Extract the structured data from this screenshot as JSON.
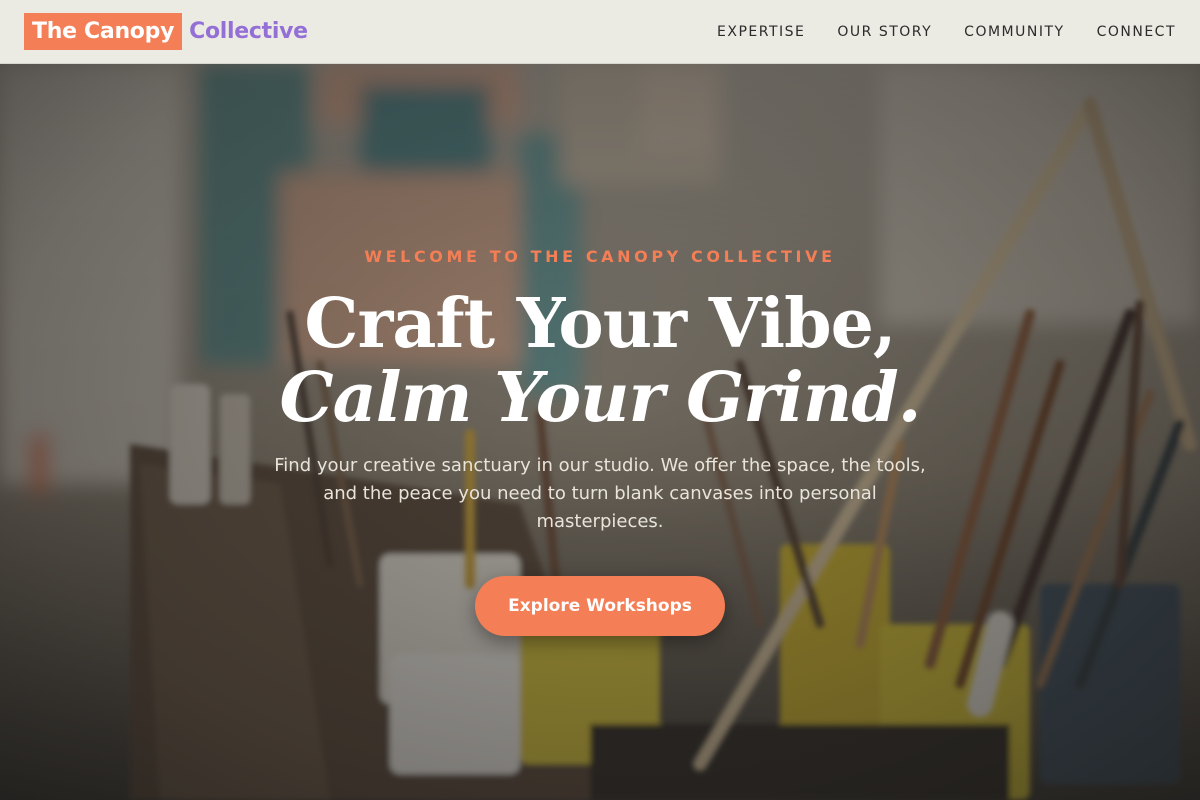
{
  "header": {
    "logo_mark": "The Canopy",
    "logo_word": "Collective",
    "nav": [
      "EXPERTISE",
      "OUR STORY",
      "COMMUNITY",
      "CONNECT"
    ]
  },
  "hero": {
    "eyebrow": "WELCOME TO THE CANOPY COLLECTIVE",
    "headline_line1": "Craft Your Vibe,",
    "headline_line2": "Calm Your Grind.",
    "lede": "Find your creative sanctuary in our studio. We offer the space, the tools, and the peace you need to turn blank canvases into personal masterpieces.",
    "cta_label": "Explore Workshops",
    "background": "art-studio-brushes-photo"
  },
  "colors": {
    "accent": "#f47e55",
    "brand_purple": "#9470d6",
    "header_bg": "#ecebe3"
  }
}
